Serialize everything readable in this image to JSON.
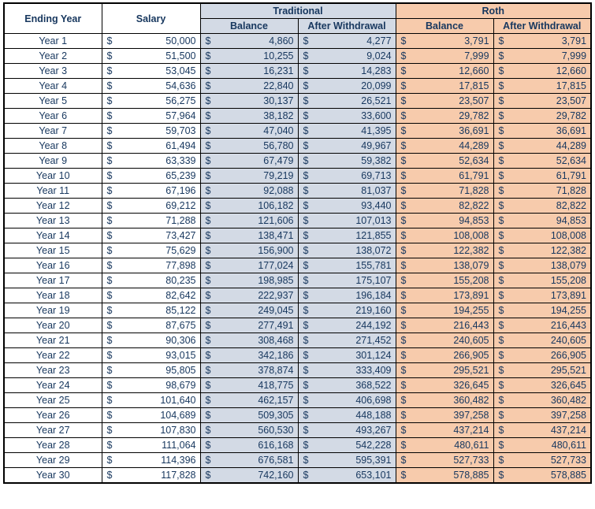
{
  "table": {
    "headers": {
      "ending_year": "Ending Year",
      "salary": "Salary",
      "traditional": "Traditional",
      "roth": "Roth",
      "balance": "Balance",
      "after_withdrawal": "After Withdrawal"
    },
    "currency_symbol": "$",
    "colors": {
      "traditional_fill": "#D3DAE5",
      "roth_fill": "#F7CBAC",
      "text": "#17375E",
      "border": "#000000",
      "sheet_background": "#FFFFFF"
    },
    "columns": [
      "Ending Year",
      "Salary",
      "Traditional Balance",
      "Traditional After Withdrawal",
      "Roth Balance",
      "Roth After Withdrawal"
    ],
    "rows": [
      {
        "year": "Year 1",
        "salary": "50,000",
        "trad_balance": "4,860",
        "trad_after": "4,277",
        "roth_balance": "3,791",
        "roth_after": "3,791"
      },
      {
        "year": "Year 2",
        "salary": "51,500",
        "trad_balance": "10,255",
        "trad_after": "9,024",
        "roth_balance": "7,999",
        "roth_after": "7,999"
      },
      {
        "year": "Year 3",
        "salary": "53,045",
        "trad_balance": "16,231",
        "trad_after": "14,283",
        "roth_balance": "12,660",
        "roth_after": "12,660"
      },
      {
        "year": "Year 4",
        "salary": "54,636",
        "trad_balance": "22,840",
        "trad_after": "20,099",
        "roth_balance": "17,815",
        "roth_after": "17,815"
      },
      {
        "year": "Year 5",
        "salary": "56,275",
        "trad_balance": "30,137",
        "trad_after": "26,521",
        "roth_balance": "23,507",
        "roth_after": "23,507"
      },
      {
        "year": "Year 6",
        "salary": "57,964",
        "trad_balance": "38,182",
        "trad_after": "33,600",
        "roth_balance": "29,782",
        "roth_after": "29,782"
      },
      {
        "year": "Year 7",
        "salary": "59,703",
        "trad_balance": "47,040",
        "trad_after": "41,395",
        "roth_balance": "36,691",
        "roth_after": "36,691"
      },
      {
        "year": "Year 8",
        "salary": "61,494",
        "trad_balance": "56,780",
        "trad_after": "49,967",
        "roth_balance": "44,289",
        "roth_after": "44,289"
      },
      {
        "year": "Year 9",
        "salary": "63,339",
        "trad_balance": "67,479",
        "trad_after": "59,382",
        "roth_balance": "52,634",
        "roth_after": "52,634"
      },
      {
        "year": "Year 10",
        "salary": "65,239",
        "trad_balance": "79,219",
        "trad_after": "69,713",
        "roth_balance": "61,791",
        "roth_after": "61,791"
      },
      {
        "year": "Year 11",
        "salary": "67,196",
        "trad_balance": "92,088",
        "trad_after": "81,037",
        "roth_balance": "71,828",
        "roth_after": "71,828"
      },
      {
        "year": "Year 12",
        "salary": "69,212",
        "trad_balance": "106,182",
        "trad_after": "93,440",
        "roth_balance": "82,822",
        "roth_after": "82,822"
      },
      {
        "year": "Year 13",
        "salary": "71,288",
        "trad_balance": "121,606",
        "trad_after": "107,013",
        "roth_balance": "94,853",
        "roth_after": "94,853"
      },
      {
        "year": "Year 14",
        "salary": "73,427",
        "trad_balance": "138,471",
        "trad_after": "121,855",
        "roth_balance": "108,008",
        "roth_after": "108,008"
      },
      {
        "year": "Year 15",
        "salary": "75,629",
        "trad_balance": "156,900",
        "trad_after": "138,072",
        "roth_balance": "122,382",
        "roth_after": "122,382"
      },
      {
        "year": "Year 16",
        "salary": "77,898",
        "trad_balance": "177,024",
        "trad_after": "155,781",
        "roth_balance": "138,079",
        "roth_after": "138,079"
      },
      {
        "year": "Year 17",
        "salary": "80,235",
        "trad_balance": "198,985",
        "trad_after": "175,107",
        "roth_balance": "155,208",
        "roth_after": "155,208"
      },
      {
        "year": "Year 18",
        "salary": "82,642",
        "trad_balance": "222,937",
        "trad_after": "196,184",
        "roth_balance": "173,891",
        "roth_after": "173,891"
      },
      {
        "year": "Year 19",
        "salary": "85,122",
        "trad_balance": "249,045",
        "trad_after": "219,160",
        "roth_balance": "194,255",
        "roth_after": "194,255"
      },
      {
        "year": "Year 20",
        "salary": "87,675",
        "trad_balance": "277,491",
        "trad_after": "244,192",
        "roth_balance": "216,443",
        "roth_after": "216,443"
      },
      {
        "year": "Year 21",
        "salary": "90,306",
        "trad_balance": "308,468",
        "trad_after": "271,452",
        "roth_balance": "240,605",
        "roth_after": "240,605"
      },
      {
        "year": "Year 22",
        "salary": "93,015",
        "trad_balance": "342,186",
        "trad_after": "301,124",
        "roth_balance": "266,905",
        "roth_after": "266,905"
      },
      {
        "year": "Year 23",
        "salary": "95,805",
        "trad_balance": "378,874",
        "trad_after": "333,409",
        "roth_balance": "295,521",
        "roth_after": "295,521"
      },
      {
        "year": "Year 24",
        "salary": "98,679",
        "trad_balance": "418,775",
        "trad_after": "368,522",
        "roth_balance": "326,645",
        "roth_after": "326,645"
      },
      {
        "year": "Year 25",
        "salary": "101,640",
        "trad_balance": "462,157",
        "trad_after": "406,698",
        "roth_balance": "360,482",
        "roth_after": "360,482"
      },
      {
        "year": "Year 26",
        "salary": "104,689",
        "trad_balance": "509,305",
        "trad_after": "448,188",
        "roth_balance": "397,258",
        "roth_after": "397,258"
      },
      {
        "year": "Year 27",
        "salary": "107,830",
        "trad_balance": "560,530",
        "trad_after": "493,267",
        "roth_balance": "437,214",
        "roth_after": "437,214"
      },
      {
        "year": "Year 28",
        "salary": "111,064",
        "trad_balance": "616,168",
        "trad_after": "542,228",
        "roth_balance": "480,611",
        "roth_after": "480,611"
      },
      {
        "year": "Year 29",
        "salary": "114,396",
        "trad_balance": "676,581",
        "trad_after": "595,391",
        "roth_balance": "527,733",
        "roth_after": "527,733"
      },
      {
        "year": "Year 30",
        "salary": "117,828",
        "trad_balance": "742,160",
        "trad_after": "653,101",
        "roth_balance": "578,885",
        "roth_after": "578,885"
      }
    ]
  }
}
